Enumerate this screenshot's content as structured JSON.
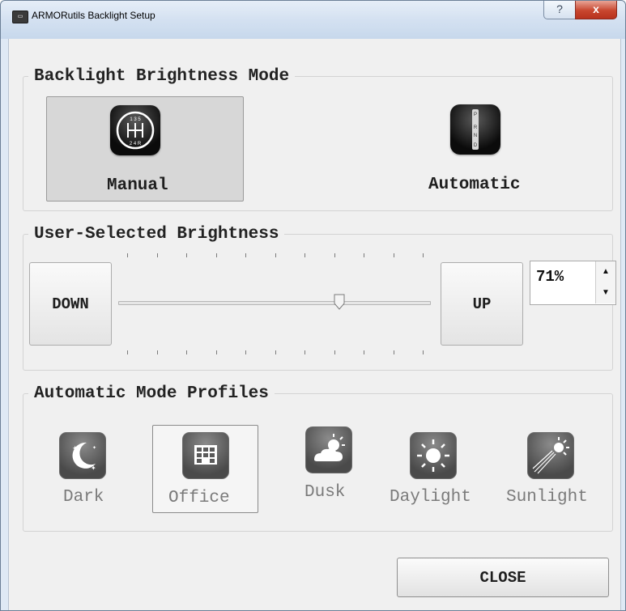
{
  "window": {
    "title": "ARMORutils Backlight Setup",
    "help_glyph": "?",
    "close_glyph": "x",
    "app_icon_text": "▭"
  },
  "mode_group": {
    "legend": "Backlight Brightness Mode",
    "manual": {
      "label": "Manual",
      "icon": "gear-shift-manual-icon",
      "selected": true,
      "pattern_top": "1 3 5",
      "pattern_bottom": "2 4 R"
    },
    "automatic": {
      "label": "Automatic",
      "icon": "gear-shift-automatic-icon",
      "selected": false,
      "gears": [
        "P",
        "R",
        "N",
        "D"
      ]
    }
  },
  "brightness_group": {
    "legend": "User-Selected Brightness",
    "down_label": "DOWN",
    "up_label": "UP",
    "slider_level_percent": 71,
    "tick_count": 11,
    "value_text": "71%",
    "spin_up_glyph": "▲",
    "spin_down_glyph": "▼"
  },
  "profiles_group": {
    "legend": "Automatic Mode Profiles",
    "items": [
      {
        "label": "Dark",
        "icon": "moon-stars-icon",
        "selected": false
      },
      {
        "label": "Office",
        "icon": "office-building-icon",
        "selected": true
      },
      {
        "label": "Dusk",
        "icon": "cloud-sun-icon",
        "selected": false
      },
      {
        "label": "Daylight",
        "icon": "sun-icon",
        "selected": false
      },
      {
        "label": "Sunlight",
        "icon": "bright-sun-rays-icon",
        "selected": false
      }
    ]
  },
  "footer": {
    "close_label": "CLOSE"
  },
  "colors": {
    "window_frame": "#dfe9f5",
    "client_bg": "#f0f0f0",
    "close_button_red": "#c8462f",
    "selected_tile": "#d7d7d7"
  }
}
